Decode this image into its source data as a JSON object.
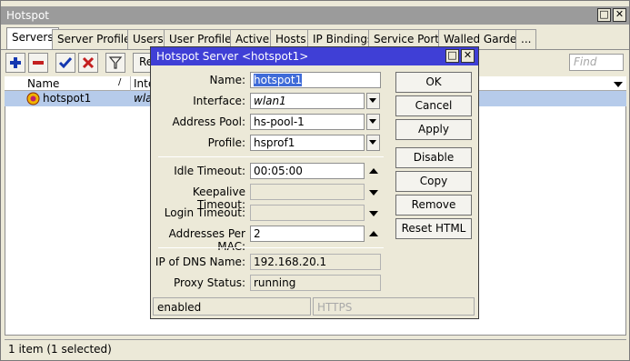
{
  "window": {
    "title": "Hotspot"
  },
  "tabs": [
    "Servers",
    "Server Profiles",
    "Users",
    "User Profiles",
    "Active",
    "Hosts",
    "IP Bindings",
    "Service Ports",
    "Walled Garden",
    "..."
  ],
  "toolbar": {
    "reset_label": "Re",
    "find_placeholder": "Find"
  },
  "list": {
    "columns": [
      "Name",
      "Inter"
    ],
    "rows": [
      {
        "name": "hotspot1",
        "interface": "wlan"
      }
    ]
  },
  "status_bar": {
    "text": "1 item (1 selected)"
  },
  "dialog": {
    "title": "Hotspot Server <hotspot1>",
    "fields": {
      "name": {
        "label": "Name:",
        "value": "hotspot1"
      },
      "interface": {
        "label": "Interface:",
        "value": "wlan1"
      },
      "address_pool": {
        "label": "Address Pool:",
        "value": "hs-pool-1"
      },
      "profile": {
        "label": "Profile:",
        "value": "hsprof1"
      },
      "idle_timeout": {
        "label": "Idle Timeout:",
        "value": "00:05:00"
      },
      "keepalive_timeout": {
        "label": "Keepalive Timeout:",
        "value": ""
      },
      "login_timeout": {
        "label": "Login Timeout:",
        "value": ""
      },
      "addresses_per_mac": {
        "label": "Addresses Per MAC:",
        "value": "2"
      },
      "ip_of_dns_name": {
        "label": "IP of DNS Name:",
        "value": "192.168.20.1"
      },
      "proxy_status": {
        "label": "Proxy Status:",
        "value": "running"
      }
    },
    "buttons": {
      "ok": "OK",
      "cancel": "Cancel",
      "apply": "Apply",
      "disable": "Disable",
      "copy": "Copy",
      "remove": "Remove",
      "reset_html": "Reset HTML"
    },
    "status": {
      "left": "enabled",
      "right": "HTTPS"
    }
  },
  "colors": {
    "dialog_title_bar": "#3f3fd6",
    "selected_row": "#b6cbea",
    "add_icon": "#1538b0",
    "remove_icon": "#c42020"
  }
}
